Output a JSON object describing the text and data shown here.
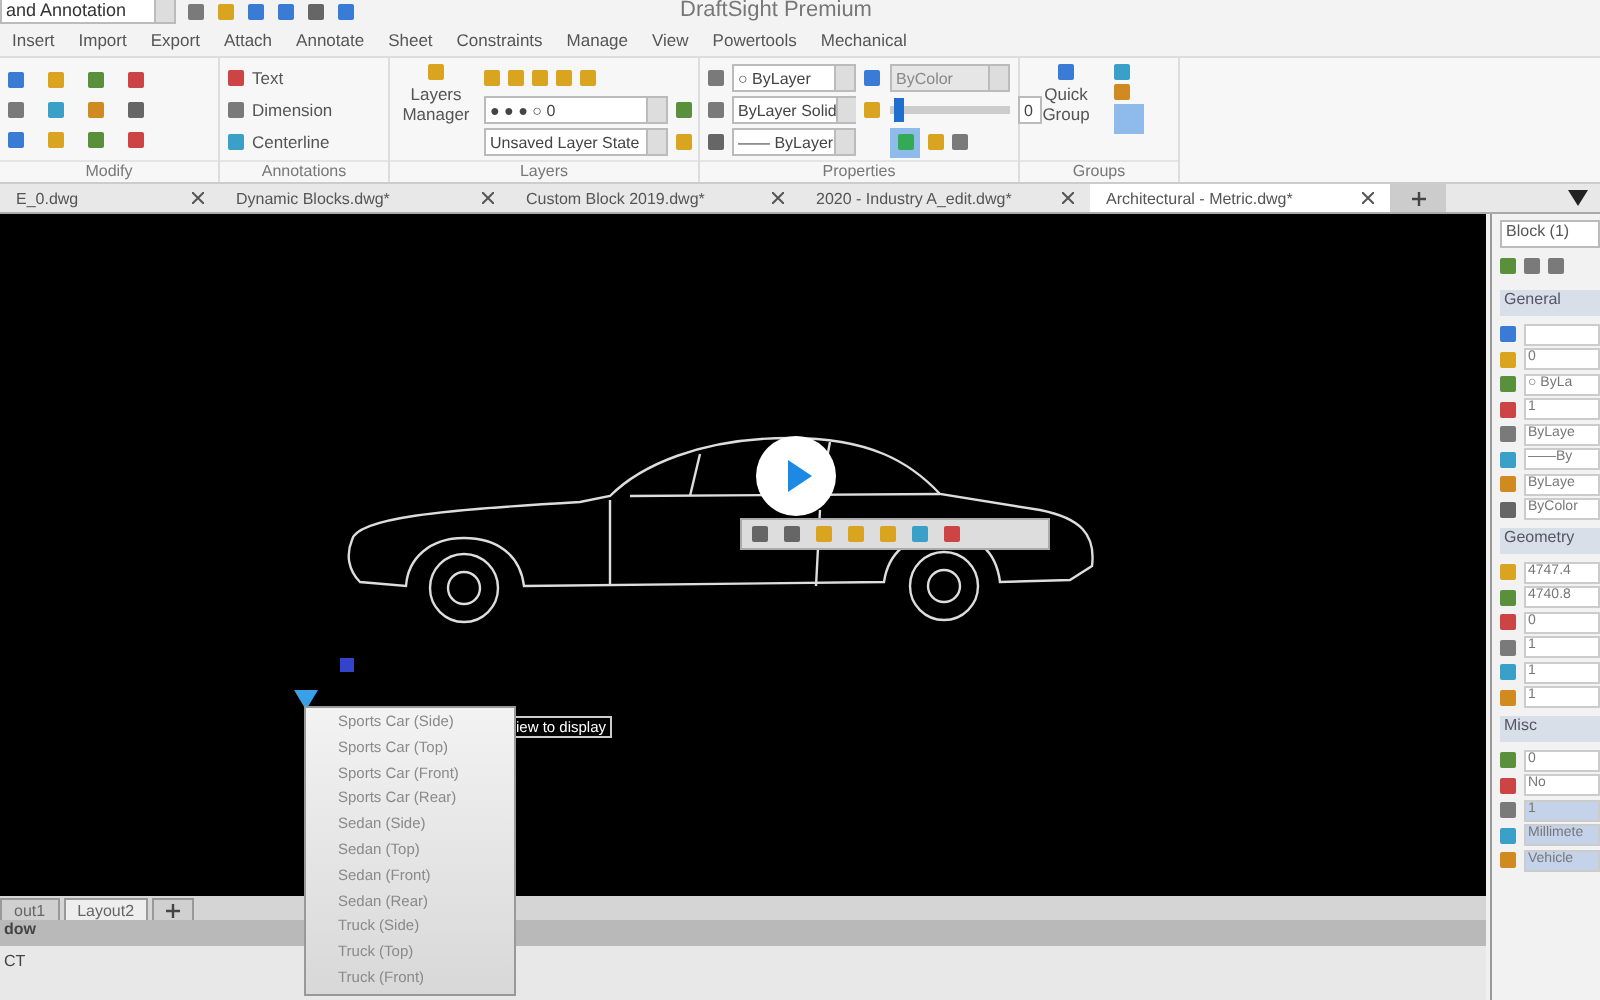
{
  "quick_access": {
    "workspace": "and Annotation"
  },
  "window": {
    "title": "DraftSight Premium"
  },
  "menu_tabs": [
    "Insert",
    "Import",
    "Export",
    "Attach",
    "Annotate",
    "Sheet",
    "Constraints",
    "Manage",
    "View",
    "Powertools",
    "Mechanical"
  ],
  "ribbon": {
    "panels": [
      {
        "kind": "modify",
        "title": "Modify"
      },
      {
        "kind": "annotations",
        "title": "Annotations",
        "items": [
          "Text",
          "Dimension",
          "Centerline"
        ]
      },
      {
        "kind": "layers",
        "title": "Layers",
        "manager": "Layers Manager",
        "layer": "● ● ● ○ 0",
        "layer_state": "Unsaved Layer State"
      },
      {
        "kind": "properties",
        "title": "Properties",
        "color_setting": "○ ByLayer",
        "linestyle": "ByLayer",
        "style": "Solid",
        "lineweight": "—— ByLayer",
        "plot_color": "ByColor",
        "transparency": "0",
        "level": 0.03
      },
      {
        "kind": "groups",
        "title": "Groups",
        "button": "Quick Group"
      }
    ]
  },
  "doc_tabs": [
    {
      "label": "E_0.dwg",
      "selected": false
    },
    {
      "label": "Dynamic Blocks.dwg*",
      "selected": false
    },
    {
      "label": "Custom Block 2019.dwg*",
      "selected": false
    },
    {
      "label": "2020 - Industry A_edit.dwg*",
      "selected": false
    },
    {
      "label": "Architectural - Metric.dwg*",
      "selected": true
    }
  ],
  "side_panel": {
    "selector": "Block (1)",
    "sections": [
      {
        "title": "General",
        "rows": [
          "",
          "0",
          "○ ByLa",
          "1",
          "ByLaye",
          "——By",
          "ByLaye",
          "ByColor"
        ]
      },
      {
        "title": "Geometry",
        "rows": [
          "4747.4",
          "4740.8",
          "0",
          "1",
          "1",
          "1"
        ]
      },
      {
        "title": "Misc",
        "rows": [
          "0",
          "No",
          "1",
          "Millimete",
          "Vehicle"
        ]
      }
    ]
  },
  "canvas": {
    "tooltip": "iew to display",
    "menu": [
      "Sports Car (Side)",
      "Sports Car (Top)",
      "Sports Car (Front)",
      "Sports Car (Rear)",
      "Sedan (Side)",
      "Sedan (Top)",
      "Sedan (Front)",
      "Sedan (Rear)",
      "Truck (Side)",
      "Truck (Top)",
      "Truck (Front)"
    ]
  },
  "sheet_tabs": [
    {
      "label": "out1",
      "selected": false
    },
    {
      "label": "Layout2",
      "selected": true
    }
  ],
  "command_window": {
    "title": "dow",
    "lines": [
      "CT"
    ]
  }
}
